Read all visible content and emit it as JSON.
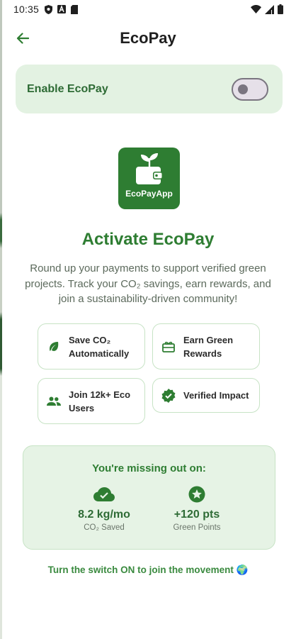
{
  "status_bar": {
    "time": "10:35",
    "left_icons": [
      "shield-icon",
      "font-a-icon",
      "sd-card-icon"
    ],
    "right_icons": [
      "wifi-icon",
      "signal-icon",
      "battery-icon"
    ]
  },
  "app_bar": {
    "title": "EcoPay",
    "back_icon": "arrow-back-icon"
  },
  "toggle_card": {
    "label": "Enable EcoPay",
    "enabled": false
  },
  "logo": {
    "text": "EcoPayApp",
    "icon": "wallet-sprout-icon"
  },
  "headline": "Activate EcoPay",
  "subtitle": "Round up your payments to support verified green projects. Track your CO₂ savings, earn rewards, and join a sustainability-driven community!",
  "features": [
    {
      "icon": "leaf-icon",
      "label": "Save CO₂ Automatically"
    },
    {
      "icon": "gift-card-icon",
      "label": "Earn Green Rewards"
    },
    {
      "icon": "people-icon",
      "label": "Join 12k+ Eco Users"
    },
    {
      "icon": "verified-badge-icon",
      "label": "Verified Impact"
    }
  ],
  "missing_out": {
    "title": "You're missing out on:",
    "stats": [
      {
        "icon": "cloud-check-icon",
        "value": "8.2 kg/mo",
        "label": "CO₂ Saved"
      },
      {
        "icon": "star-badge-icon",
        "value": "+120 pts",
        "label": "Green Points"
      }
    ]
  },
  "cta": "Turn the switch ON to join the movement 🌍",
  "colors": {
    "primary_green": "#2e7d32",
    "card_green": "#e3f2e2",
    "border_green": "#c7e3c5",
    "text_dark": "#1f1f1f",
    "text_muted": "#5c6a5c"
  }
}
